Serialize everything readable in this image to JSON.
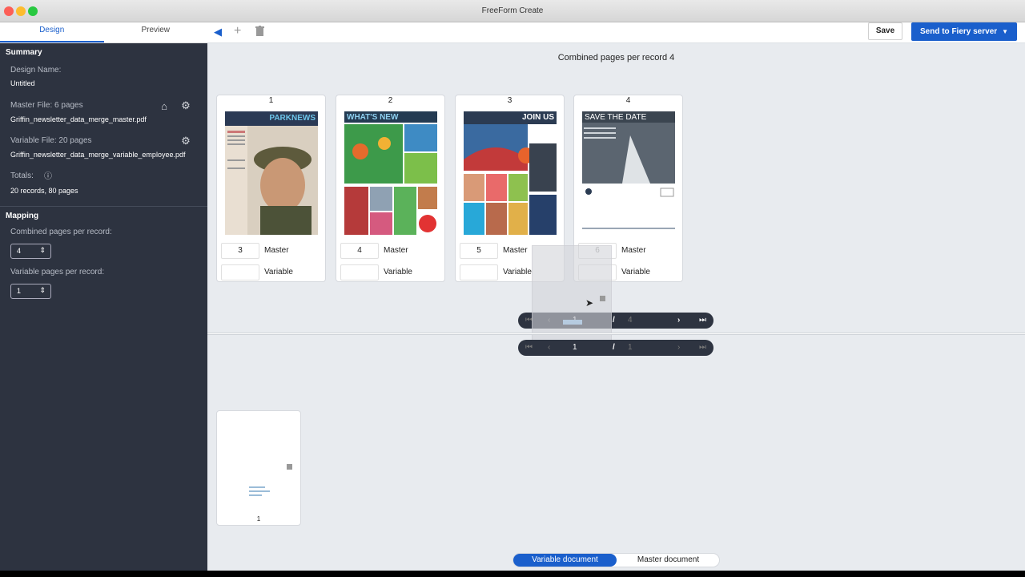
{
  "window": {
    "title": "FreeForm Create"
  },
  "sidebar": {
    "tabs": [
      {
        "label": "Design",
        "active": true
      },
      {
        "label": "Preview",
        "active": false
      }
    ],
    "summary": {
      "heading": "Summary",
      "design_name_label": "Design Name:",
      "design_name": "Untitled",
      "master_file_label": "Master File: 6 pages",
      "master_file": "Griffin_newsletter_data_merge_master.pdf",
      "variable_file_label": "Variable File: 20 pages",
      "variable_file": "Griffin_newsletter_data_merge_variable_employee.pdf",
      "totals_label": "Totals:",
      "totals": "20 records, 80 pages"
    },
    "mapping": {
      "heading": "Mapping",
      "combined_label": "Combined pages per record:",
      "combined_value": "4",
      "variable_label": "Variable pages per record:",
      "variable_value": "1"
    }
  },
  "toolbar": {
    "save_label": "Save",
    "send_label": "Send to Fiery server"
  },
  "main": {
    "combined_label": "Combined pages per record 4",
    "pages": [
      {
        "number": "1",
        "master_page": "3",
        "master_label": "Master",
        "variable_label": "Variable",
        "thumb_title": "PARKNEWS"
      },
      {
        "number": "2",
        "master_page": "4",
        "master_label": "Master",
        "variable_label": "Variable",
        "thumb_title": "WHAT'S NEW"
      },
      {
        "number": "3",
        "master_page": "5",
        "master_label": "Master",
        "variable_label": "Variable",
        "thumb_title": "JOIN US"
      },
      {
        "number": "4",
        "master_page": "6",
        "master_label": "Master",
        "variable_label": "Variable",
        "thumb_title": "SAVE THE DATE"
      }
    ],
    "top_pager": {
      "current": "1",
      "sep": "/",
      "total": "4"
    },
    "bottom_pager": {
      "current": "1",
      "sep": "/",
      "total": "1"
    },
    "variable_page": {
      "number": "1"
    },
    "toggle": {
      "variable": "Variable document",
      "master": "Master document"
    }
  }
}
